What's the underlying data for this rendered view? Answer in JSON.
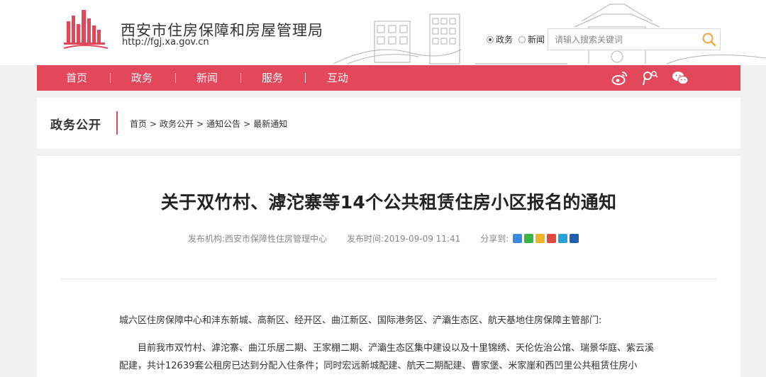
{
  "header": {
    "site_name": "西安市住房保障和房屋管理局",
    "site_url": "http://fgj.xa.gov.cn",
    "brand_color": "#e2475a",
    "search": {
      "scopes": [
        {
          "label": "政务",
          "checked": true
        },
        {
          "label": "新闻",
          "checked": false
        }
      ],
      "placeholder": "请输入搜索关键词",
      "value": ""
    }
  },
  "nav": {
    "items": [
      "首页",
      "政务",
      "新闻",
      "服务",
      "互动"
    ],
    "social_icons": [
      "weibo-icon",
      "people-icon",
      "wechat-icon"
    ]
  },
  "section": {
    "title": "政务公开",
    "breadcrumb": [
      "首页",
      "政务公开",
      "通知公告",
      "最新通知"
    ],
    "separator": ">"
  },
  "article": {
    "title": "关于双竹村、滹沱寨等14个公共租赁住房小区报名的通知",
    "publisher_label": "发布机构:",
    "publisher": "西安市保障性住房管理中心",
    "date_label": "发布时间:",
    "date": "2019-09-09 11:41",
    "share_label": "分享到:",
    "share_icons": [
      "qzone-icon",
      "wechat-icon",
      "qq-icon",
      "weibo-icon",
      "tencent-icon",
      "renren-icon"
    ],
    "paragraphs": [
      "城六区住房保障中心和沣东新城、高新区、经开区、曲江新区、国际港务区、浐灞生态区、航天基地住房保障主管部门:",
      "目前我市双竹村、滹沱寨、曲江乐居二期、王家棚二期、浐灞生态区集中建设以及十里锦绣、天伦佐治公馆、瑞景华庭、紫云溪配建，共计12639套公租房已达到分配入住条件；同时宏远新城配建、航天二期配建、曹家堡、米家崖和西凹里公共租赁住房小"
    ]
  }
}
